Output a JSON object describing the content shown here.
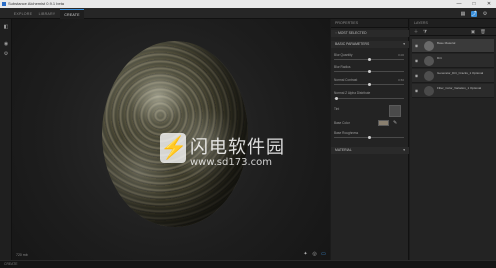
{
  "window": {
    "title": "Substance Alchemist 0.9.1 beta",
    "controls": [
      "—",
      "□",
      "✕"
    ]
  },
  "tabs": [
    {
      "label": "EXPLORE",
      "active": false
    },
    {
      "label": "LIBRARY",
      "active": false
    },
    {
      "label": "CREATE",
      "active": true
    }
  ],
  "top_icons": [
    "grid-icon",
    "export-icon",
    "settings-icon"
  ],
  "left_rail_icons": [
    "layers-icon",
    "library-icon",
    "settings-icon"
  ],
  "viewport": {
    "status": "720 mb",
    "tools": [
      "lighting-icon",
      "camera-icon",
      "material-icon"
    ]
  },
  "watermark": {
    "logo_glyph": "⚡",
    "text": "闪电软件园",
    "url": "www.sd173.com"
  },
  "properties": {
    "header": "PROPERTIES",
    "material_label": "MOST SELECTED",
    "section_basic": "BASIC PARAMETERS",
    "params": [
      {
        "label": "Blur Quantity",
        "value": "0.00",
        "fraction": 0.5
      },
      {
        "label": "Blur Radius",
        "value": "",
        "fraction": 0.5
      },
      {
        "label": "Normal Contrast",
        "value": "0.50",
        "fraction": 0.5
      },
      {
        "label": "Normal Z Alpha Distribute",
        "value": "",
        "fraction": 0.02
      }
    ],
    "tint_label": "Tint",
    "color_label": "Base Color",
    "roughness_label": "Base Roughness",
    "roughness_fraction": 0.5,
    "section_material": "MATERIAL"
  },
  "layers": {
    "header": "LAYERS",
    "toolbar_icons": [
      "add-icon",
      "filter-icon",
      "folder-icon",
      "delete-icon"
    ],
    "items": [
      {
        "name": "Base Material",
        "selected": true,
        "thumb": "#6a6a6a"
      },
      {
        "name": "Dirt",
        "selected": false,
        "thumb": "#555555"
      },
      {
        "name": "Generator_Dirt_Cracks_1 Optional",
        "selected": false,
        "thumb": "#4e4e4e"
      },
      {
        "name": "Filter_Color_Variation_1 Optional",
        "selected": false,
        "thumb": "#4a4a4a"
      }
    ]
  },
  "statusbar": {
    "text": "CREATE"
  },
  "colors": {
    "accent": "#3b8fd9",
    "panel": "#232323",
    "viewport": "#1d1d1d"
  }
}
